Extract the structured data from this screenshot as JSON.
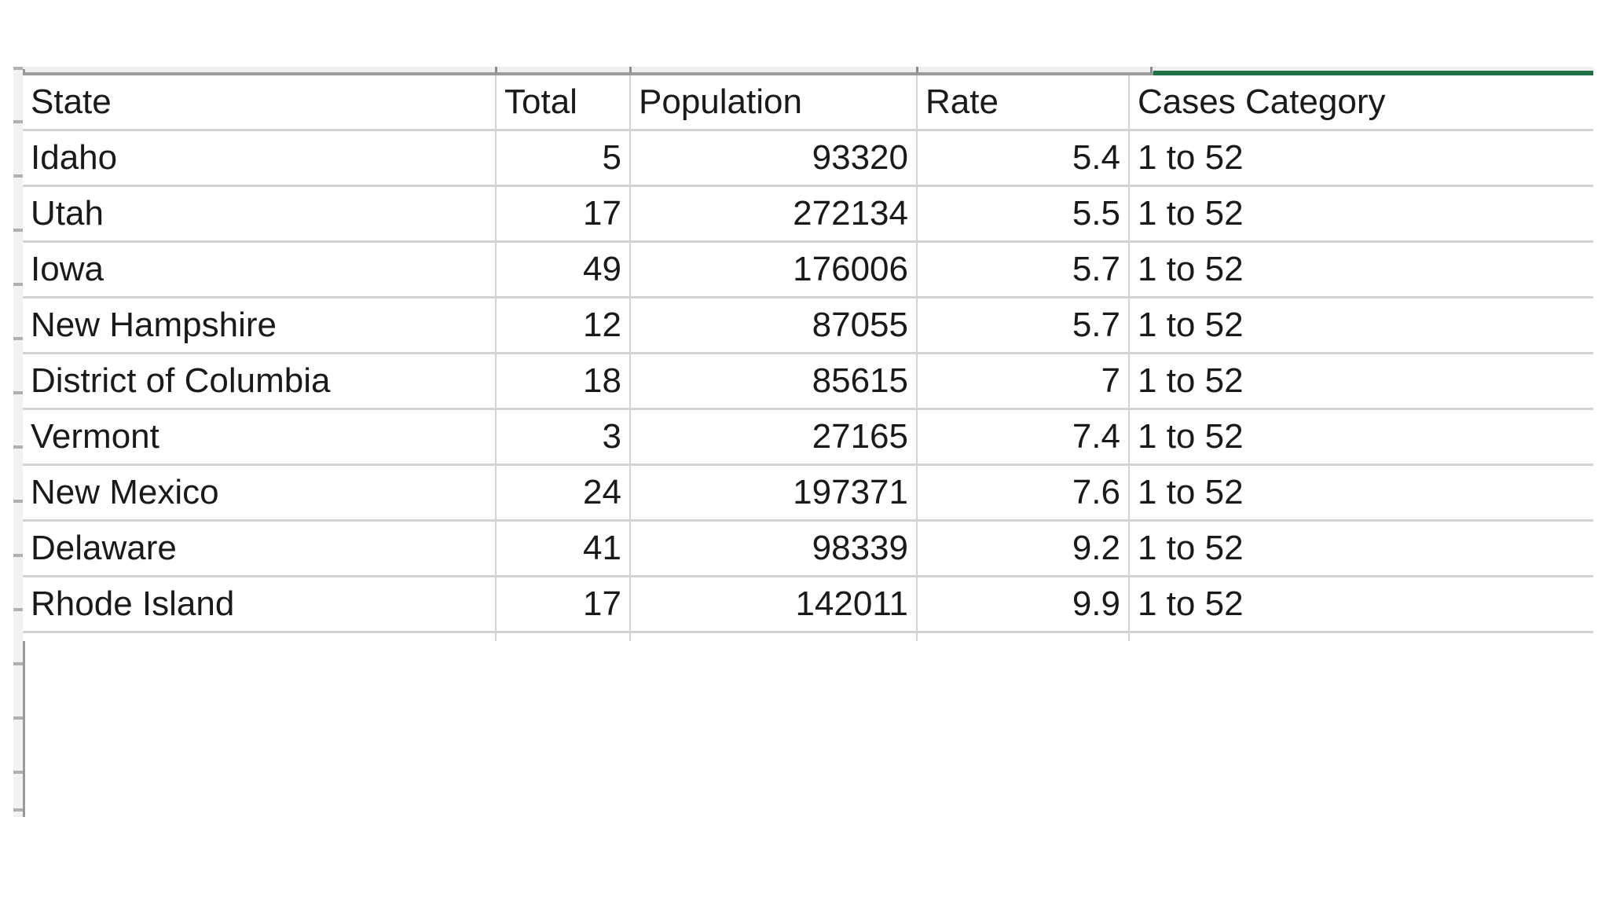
{
  "table": {
    "columns": [
      {
        "key": "state",
        "label": "State",
        "align": "left"
      },
      {
        "key": "total",
        "label": "Total",
        "align": "right"
      },
      {
        "key": "population",
        "label": "Population",
        "align": "right"
      },
      {
        "key": "rate",
        "label": "Rate",
        "align": "right"
      },
      {
        "key": "category",
        "label": "Cases Category",
        "align": "left"
      }
    ],
    "rows": [
      {
        "state": "Idaho",
        "total": "5",
        "population": "93320",
        "rate": "5.4",
        "category": "1 to 52"
      },
      {
        "state": "Utah",
        "total": "17",
        "population": "272134",
        "rate": "5.5",
        "category": "1 to 52"
      },
      {
        "state": "Iowa",
        "total": "49",
        "population": "176006",
        "rate": "5.7",
        "category": "1 to 52"
      },
      {
        "state": "New Hampshire",
        "total": "12",
        "population": "87055",
        "rate": "5.7",
        "category": "1 to 52"
      },
      {
        "state": "District of Columbia",
        "total": "18",
        "population": "85615",
        "rate": "7",
        "category": "1 to 52"
      },
      {
        "state": "Vermont",
        "total": "3",
        "population": "27165",
        "rate": "7.4",
        "category": "1 to 52"
      },
      {
        "state": "New Mexico",
        "total": "24",
        "population": "197371",
        "rate": "7.6",
        "category": "1 to 52"
      },
      {
        "state": "Delaware",
        "total": "41",
        "population": "98339",
        "rate": "9.2",
        "category": "1 to 52"
      },
      {
        "state": "Rhode Island",
        "total": "17",
        "population": "142011",
        "rate": "9.9",
        "category": "1 to 52"
      }
    ]
  },
  "colors": {
    "accent_green": "#1e7145",
    "grid_line": "#d3d3d3",
    "header_rule": "#9a9a9a",
    "gutter": "#f0f0f0",
    "text": "#1a1a1a",
    "background": "#ffffff"
  },
  "chart_data": {
    "type": "table",
    "title": "",
    "columns": [
      "State",
      "Total",
      "Population",
      "Rate",
      "Cases Category"
    ],
    "rows": [
      [
        "Idaho",
        5,
        93320,
        5.4,
        "1 to 52"
      ],
      [
        "Utah",
        17,
        272134,
        5.5,
        "1 to 52"
      ],
      [
        "Iowa",
        49,
        176006,
        5.7,
        "1 to 52"
      ],
      [
        "New Hampshire",
        12,
        87055,
        5.7,
        "1 to 52"
      ],
      [
        "District of Columbia",
        18,
        85615,
        7,
        "1 to 52"
      ],
      [
        "Vermont",
        3,
        27165,
        7.4,
        "1 to 52"
      ],
      [
        "New Mexico",
        24,
        197371,
        7.6,
        "1 to 52"
      ],
      [
        "Delaware",
        41,
        98339,
        9.2,
        "1 to 52"
      ],
      [
        "Rhode Island",
        17,
        142011,
        9.9,
        "1 to 52"
      ]
    ]
  }
}
